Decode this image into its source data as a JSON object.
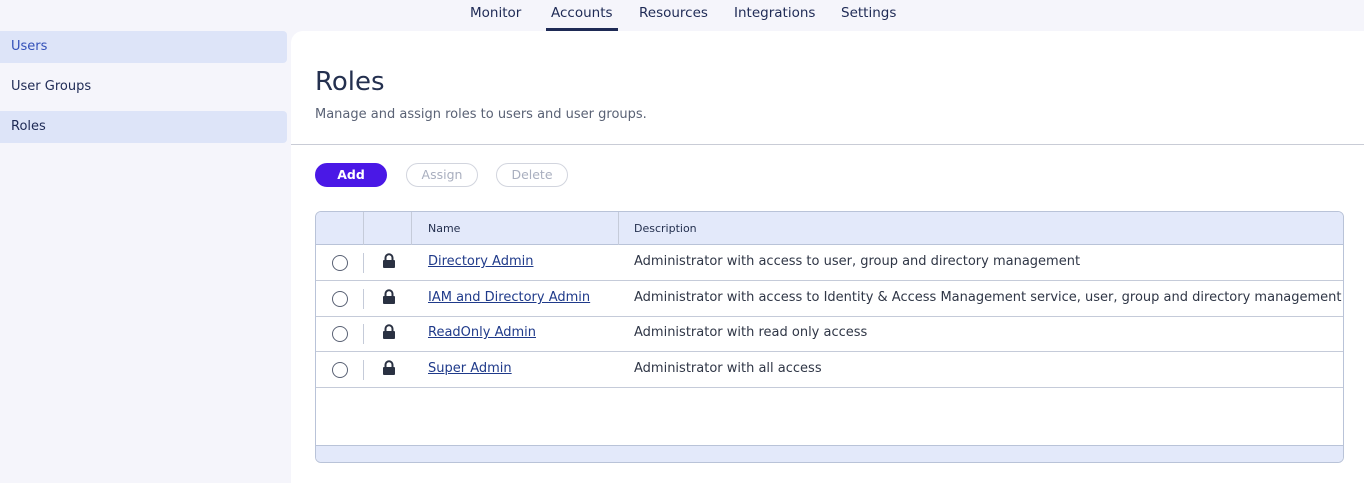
{
  "topnav": {
    "tabs": [
      {
        "label": "Monitor"
      },
      {
        "label": "Accounts"
      },
      {
        "label": "Resources"
      },
      {
        "label": "Integrations"
      },
      {
        "label": "Settings"
      }
    ],
    "active_tab": "Accounts"
  },
  "sidebar": {
    "items": [
      {
        "label": "Users"
      },
      {
        "label": "User Groups"
      },
      {
        "label": "Roles"
      }
    ],
    "selected": "Roles"
  },
  "page": {
    "title": "Roles",
    "subtitle": "Manage and assign roles to users and user groups."
  },
  "toolbar": {
    "add_label": "Add",
    "assign_label": "Assign",
    "delete_label": "Delete"
  },
  "table": {
    "columns": {
      "name": "Name",
      "description": "Description"
    },
    "rows": [
      {
        "name": "Directory Admin",
        "description": "Administrator with access to user, group and directory management"
      },
      {
        "name": "IAM and Directory Admin",
        "description": "Administrator with access to Identity & Access Management service, user, group and directory management"
      },
      {
        "name": "ReadOnly Admin",
        "description": "Administrator with read only access"
      },
      {
        "name": "Super Admin",
        "description": "Administrator with all access"
      }
    ]
  },
  "colors": {
    "accent": "#4a18e6",
    "nav_text": "#1e2a55",
    "selected_bg": "#dde4f8",
    "table_header_bg": "#e3e9fa",
    "link": "#1f3a8a"
  },
  "icons": {
    "row_lock": "lock-icon",
    "row_select": "radio-button"
  }
}
